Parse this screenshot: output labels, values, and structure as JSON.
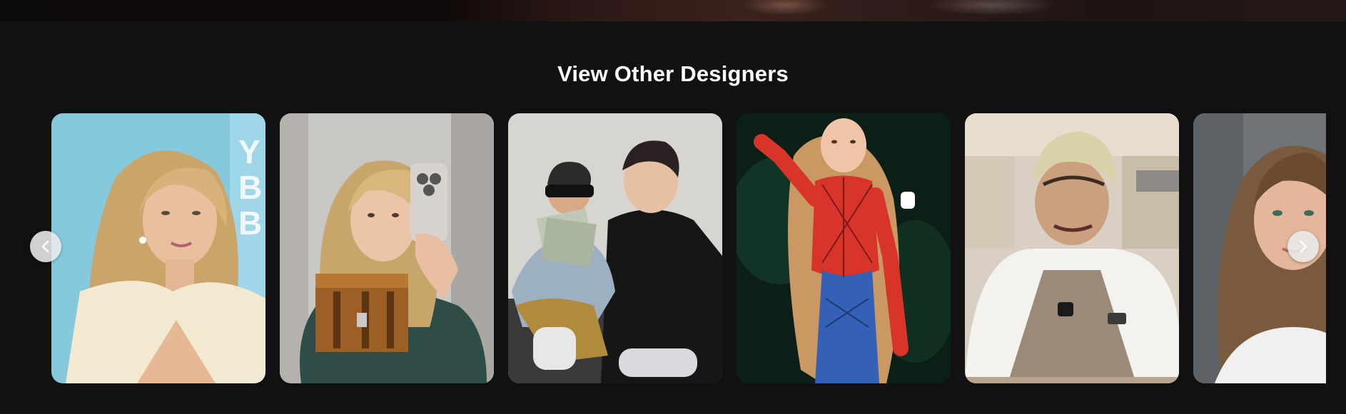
{
  "section": {
    "title": "View Other Designers"
  },
  "carousel": {
    "prev_icon": "chevron-left-icon",
    "next_icon": "chevron-right-icon",
    "cards": [
      {
        "name": "designer-card-1",
        "photo": "portrait-blonde-woman-cream-dress",
        "accent": "#7fc6dc"
      },
      {
        "name": "designer-card-2",
        "photo": "mirror-selfie-woman-holding-chest-toy",
        "accent": "#2f4a46"
      },
      {
        "name": "designer-card-3",
        "photo": "man-and-child-holding-money",
        "accent": "#1c1c1c"
      },
      {
        "name": "designer-card-4",
        "photo": "woman-in-spider-suit-costume",
        "accent": "#d8342a"
      },
      {
        "name": "designer-card-5",
        "photo": "man-in-white-shirt-apron-kitchen",
        "accent": "#ece9e4"
      },
      {
        "name": "designer-card-6",
        "photo": "portrait-brunette-woman",
        "accent": "#6f7478"
      }
    ]
  },
  "colors": {
    "background": "#111111",
    "title_text": "#ffffff",
    "nav_button": "#ebebeb"
  }
}
